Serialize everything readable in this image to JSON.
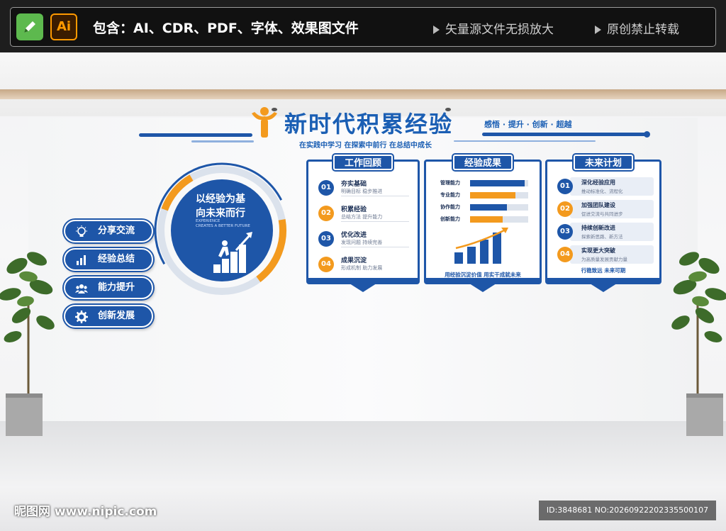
{
  "banner": {
    "ps_icon": "pen-icon",
    "ai_label": "Ai",
    "contains_label": "包含：AI、CDR、PDF、字体、效果图文件",
    "right_1": "矢量源文件无损放大",
    "right_2": "原创禁止转载"
  },
  "display": {
    "title": "新时代积累经验",
    "slogan": "感悟 · 提升 · 创新 · 超越",
    "subtitle": "在实践中学习 在探索中前行 在总结中成长",
    "pills": [
      {
        "label": "分享交流",
        "icon": "lightbulb-icon"
      },
      {
        "label": "经验总结",
        "icon": "bar-chart-icon"
      },
      {
        "label": "能力提升",
        "icon": "team-icon"
      },
      {
        "label": "创新发展",
        "icon": "gear-icon"
      }
    ],
    "circle": {
      "line1": "以经验为基",
      "line2": "向未来而行",
      "en1": "EXPERIENCE",
      "en2": "CREATES A BETTER FUTURE"
    },
    "review": {
      "heading": "工作回顾",
      "items": [
        {
          "num": "01",
          "title": "夯实基础",
          "desc": "明确目标 稳步推进"
        },
        {
          "num": "02",
          "title": "积累经验",
          "desc": "总结方法 提升能力"
        },
        {
          "num": "03",
          "title": "优化改进",
          "desc": "发现问题 持续完善"
        },
        {
          "num": "04",
          "title": "成果沉淀",
          "desc": "形成机制 助力发展"
        }
      ]
    },
    "results": {
      "heading": "经验成果",
      "bars": [
        {
          "label": "管理能力",
          "value": 0.94,
          "color": "#1e56a8"
        },
        {
          "label": "专业能力",
          "value": 0.78,
          "color": "#f39a1e"
        },
        {
          "label": "协作能力",
          "value": 0.64,
          "color": "#1e56a8"
        },
        {
          "label": "创新能力",
          "value": 0.56,
          "color": "#f39a1e"
        }
      ],
      "footer": "用经验沉淀价值 用实干成就未来"
    },
    "plan": {
      "heading": "未来计划",
      "items": [
        {
          "num": "01",
          "title": "深化经验应用",
          "desc": "推动标准化、流程化"
        },
        {
          "num": "02",
          "title": "加强团队建设",
          "desc": "促进交流与共同进步"
        },
        {
          "num": "03",
          "title": "持续创新改进",
          "desc": "探索新思路、新方法"
        },
        {
          "num": "04",
          "title": "实现更大突破",
          "desc": "为高质量发展贡献力量"
        }
      ],
      "footer": "行稳致远 未来可期"
    }
  },
  "watermark": {
    "site": "昵图网 www.nipic.com",
    "id": "ID:3848681 NO:20260922202335500107"
  },
  "colors": {
    "brand_blue": "#1e56a8",
    "accent_orange": "#f39a1e"
  }
}
